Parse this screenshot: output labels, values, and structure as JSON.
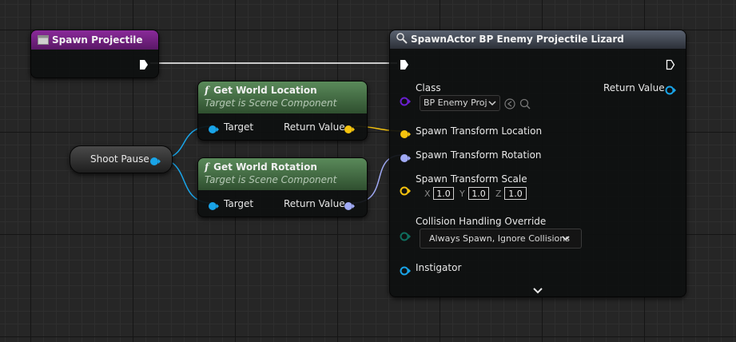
{
  "colors": {
    "exec": "#ffffff",
    "object": "#19a4e8",
    "vector": "#f5c30e",
    "rotator": "#a0aaf5",
    "transform": "#f0a020",
    "class": "#6a1fd0",
    "enum": "#0e6e5e",
    "event_header": "#7a1f8a",
    "function_header": "#3c6a3c",
    "spawn_header": "#3a3f48"
  },
  "event_node": {
    "title": "Spawn Projectile",
    "icon": "event-icon"
  },
  "get_location_node": {
    "icon": "function-icon",
    "title": "Get World Location",
    "subtitle": "Target is Scene Component",
    "input_label": "Target",
    "output_label": "Return Value"
  },
  "get_rotation_node": {
    "icon": "function-icon",
    "title": "Get World Rotation",
    "subtitle": "Target is Scene Component",
    "input_label": "Target",
    "output_label": "Return Value"
  },
  "variable_node": {
    "label": "Shoot Pause"
  },
  "spawn_node": {
    "icon": "spawn-actor-icon",
    "title": "SpawnActor BP Enemy Projectile Lizard",
    "class_label": "Class",
    "class_value": "BP Enemy Proje",
    "return_label": "Return Value",
    "location_label": "Spawn Transform Location",
    "rotation_label": "Spawn Transform Rotation",
    "scale_label": "Spawn Transform Scale",
    "scale": {
      "x_label": "X",
      "x": "1.0",
      "y_label": "Y",
      "y": "1.0",
      "z_label": "Z",
      "z": "1.0"
    },
    "collision_label": "Collision Handling Override",
    "collision_value": "Always Spawn, Ignore Collisions",
    "instigator_label": "Instigator"
  }
}
